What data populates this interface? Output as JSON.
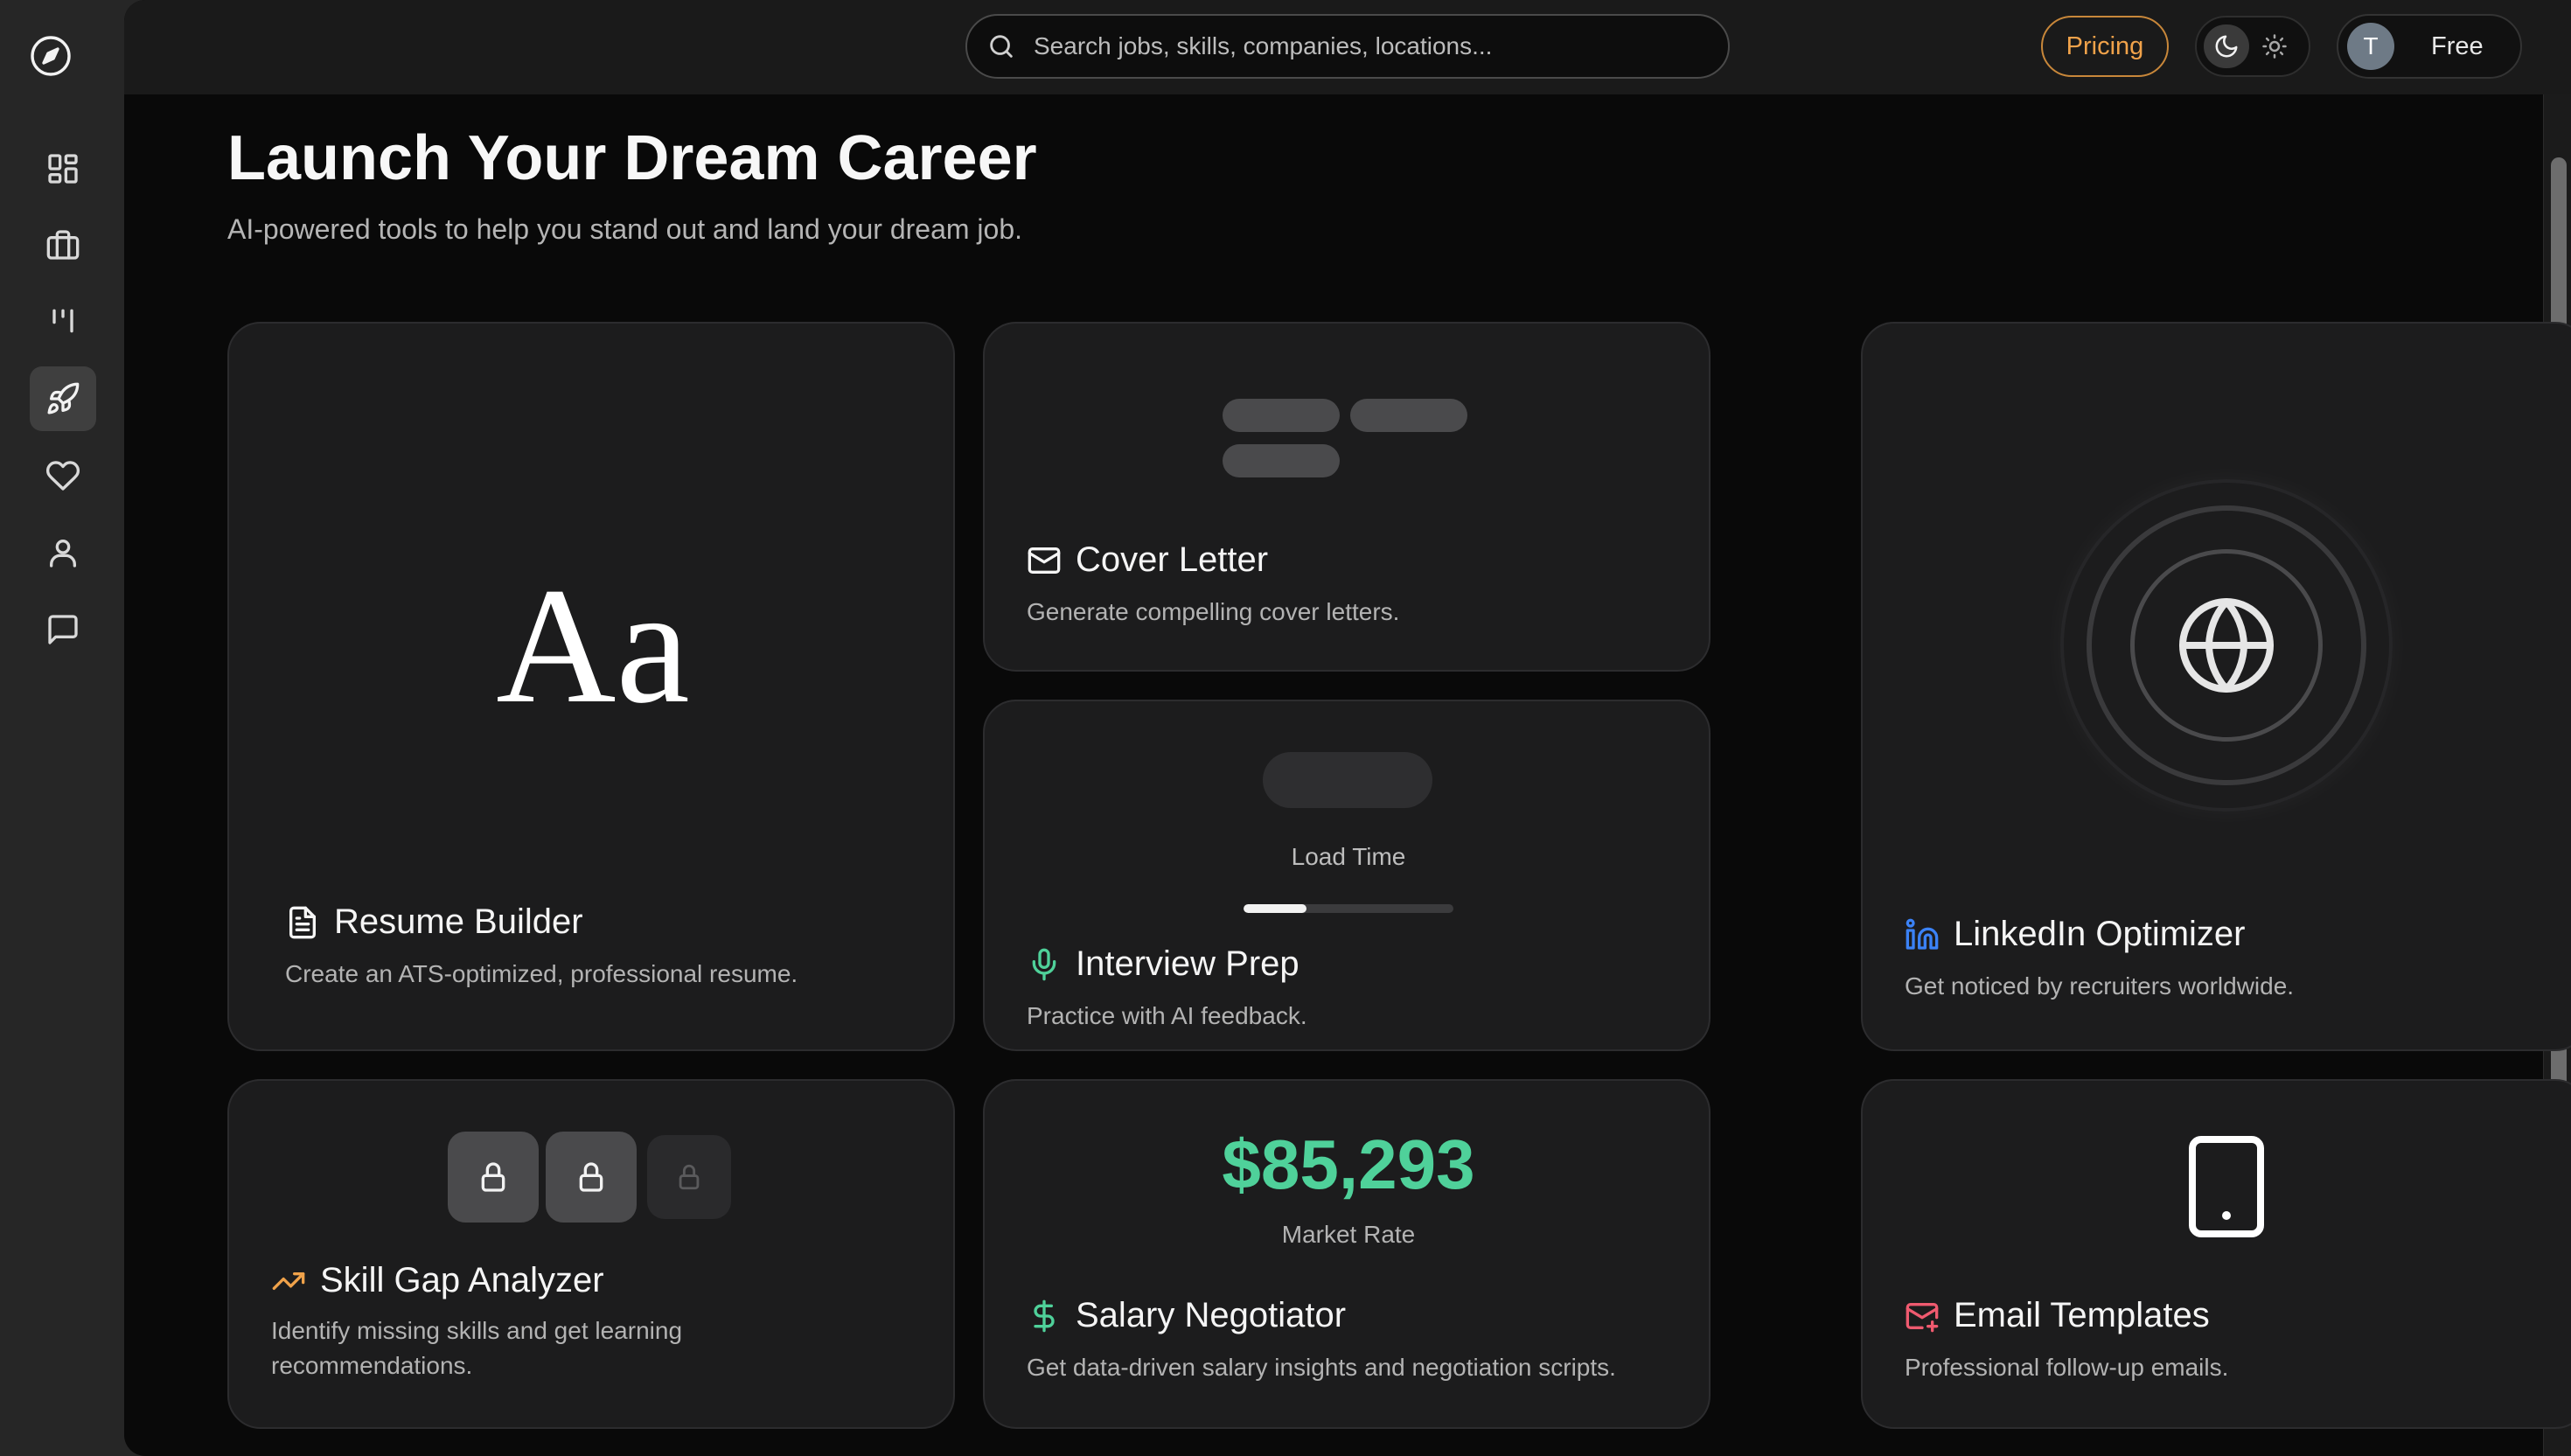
{
  "search": {
    "placeholder": "Search jobs, skills, companies, locations..."
  },
  "topbar": {
    "pricing_label": "Pricing",
    "user_initial": "T",
    "plan_label": "Free"
  },
  "header": {
    "title": "Launch Your Dream Career",
    "subtitle": "AI-powered tools to help you stand out and land your dream job."
  },
  "sidebar": {
    "items": [
      {
        "icon": "dashboard-icon"
      },
      {
        "icon": "briefcase-icon"
      },
      {
        "icon": "kanban-icon"
      },
      {
        "icon": "rocket-icon",
        "active": true
      },
      {
        "icon": "heart-icon"
      },
      {
        "icon": "user-icon"
      },
      {
        "icon": "message-icon"
      }
    ]
  },
  "cards": {
    "resume": {
      "preview": "Aa",
      "title": "Resume Builder",
      "description": "Create an ATS-optimized, professional resume.",
      "icon": "document-icon"
    },
    "cover_letter": {
      "title": "Cover Letter",
      "description": "Generate compelling cover letters.",
      "icon": "mail-icon"
    },
    "interview": {
      "load_label": "Load Time",
      "load_progress": 0.3,
      "title": "Interview Prep",
      "description": "Practice with AI feedback.",
      "icon": "microphone-icon",
      "accent": "#4fd19a"
    },
    "linkedin": {
      "title": "LinkedIn Optimizer",
      "description": "Get noticed by recruiters worldwide.",
      "icon": "linkedin-icon",
      "accent": "#3b82f6"
    },
    "skill_gap": {
      "title": "Skill Gap Analyzer",
      "description": "Identify missing skills and get learning recommendations.",
      "icon": "trending-up-icon",
      "accent": "#f0a24a"
    },
    "salary": {
      "value": "$85,293",
      "value_label": "Market Rate",
      "title": "Salary Negotiator",
      "description": "Get data-driven salary insights and negotiation scripts.",
      "icon": "dollar-icon",
      "accent": "#4fd19a"
    },
    "email": {
      "title": "Email Templates",
      "description": "Professional follow-up emails.",
      "icon": "mail-plus-icon",
      "accent": "#ef5a6f"
    }
  },
  "colors": {
    "accent_orange": "#f0a24a",
    "accent_green": "#4fd19a",
    "accent_blue": "#3b82f6",
    "accent_red": "#ef5a6f"
  }
}
